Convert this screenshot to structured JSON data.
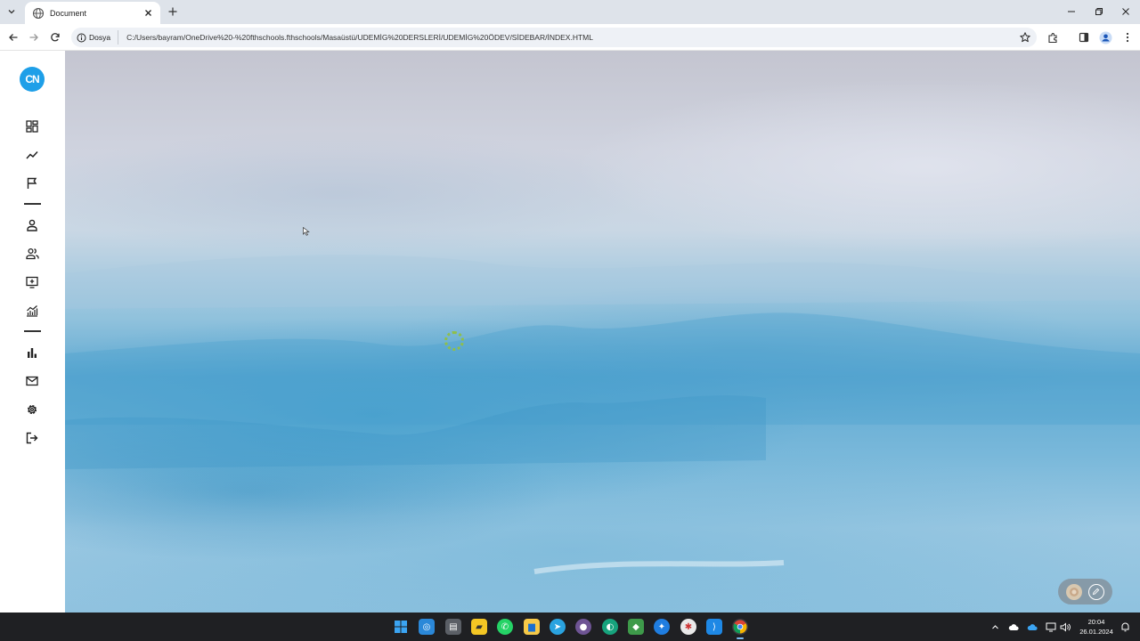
{
  "browser": {
    "tab_title": "Document",
    "site_info_label": "Dosya",
    "url": "C:/Users/bayram/OneDrive%20-%20fthschools.fthschools/Masaüstü/UDEMİG%20DERSLERİ/UDEMİG%20ÖDEV/SİDEBAR/İNDEX.HTML"
  },
  "logo": {
    "text": "CN",
    "color": "#1e9fe8"
  },
  "sidebar": {
    "items": [
      {
        "icon": "dashboard-icon"
      },
      {
        "icon": "trending-line-icon"
      },
      {
        "icon": "flag-icon"
      },
      {
        "icon": "person-icon"
      },
      {
        "icon": "people-icon"
      },
      {
        "icon": "add-to-queue-icon"
      },
      {
        "icon": "insights-chart-icon"
      },
      {
        "icon": "bar-chart-icon"
      },
      {
        "icon": "mail-icon"
      },
      {
        "icon": "settings-gear-icon"
      },
      {
        "icon": "logout-icon"
      }
    ]
  },
  "taskbar": {
    "clock_time": "20:04",
    "clock_date": "26.01.2024"
  }
}
